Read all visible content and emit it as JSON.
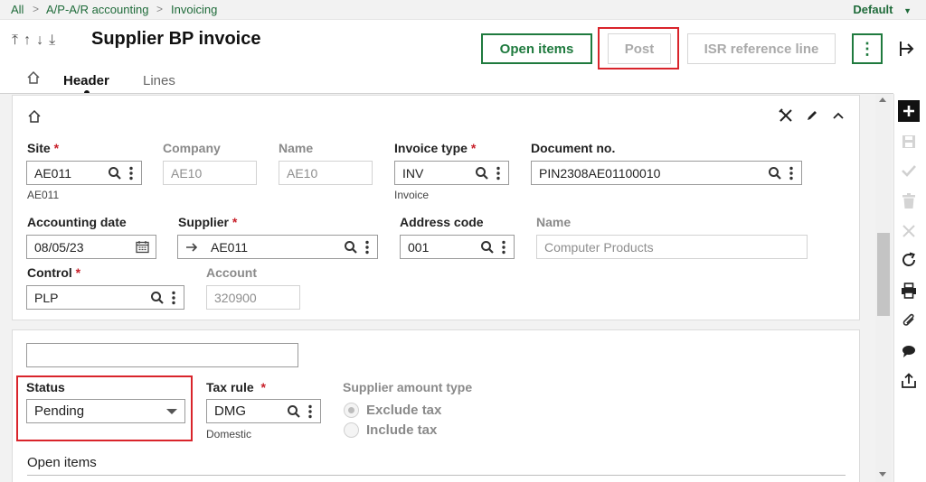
{
  "breadcrumb": {
    "items": [
      "All",
      "A/P-A/R accounting",
      "Invoicing"
    ],
    "separator": ">"
  },
  "user_menu": {
    "label": "Default"
  },
  "title": "Supplier BP invoice",
  "nav_arrows": "⤒↑↓⤓",
  "actions": {
    "open_items": "Open items",
    "post": "Post",
    "isr": "ISR reference line",
    "more": "⋮"
  },
  "tabs": {
    "header": "Header",
    "lines": "Lines"
  },
  "form": {
    "site": {
      "label": "Site",
      "value": "AE011",
      "sub": "AE011"
    },
    "company": {
      "label": "Company",
      "value": "AE10"
    },
    "name1": {
      "label": "Name",
      "value": "AE10"
    },
    "invoice_type": {
      "label": "Invoice type",
      "value": "INV",
      "sub": "Invoice"
    },
    "document_no": {
      "label": "Document no.",
      "value": "PIN2308AE01100010"
    },
    "accounting_date": {
      "label": "Accounting date",
      "value": "08/05/23"
    },
    "supplier": {
      "label": "Supplier",
      "value": "AE011"
    },
    "address_code": {
      "label": "Address code",
      "value": "001"
    },
    "name2": {
      "label": "Name",
      "value": "Computer Products"
    },
    "control": {
      "label": "Control",
      "value": "PLP"
    },
    "account": {
      "label": "Account",
      "value": "320900"
    },
    "required_mark": "*"
  },
  "section2": {
    "blank_field": "",
    "status": {
      "label": "Status",
      "value": "Pending"
    },
    "tax_rule": {
      "label": "Tax rule",
      "value": "DMG",
      "sub": "Domestic"
    },
    "supplier_amount_type": {
      "label": "Supplier amount type",
      "options": [
        "Exclude tax",
        "Include tax"
      ],
      "selected": "Exclude tax"
    },
    "open_items": "Open items"
  },
  "colors": {
    "brand_green": "#1f7a3e",
    "highlight_red": "#d9242b",
    "required_red": "#c8202a"
  }
}
